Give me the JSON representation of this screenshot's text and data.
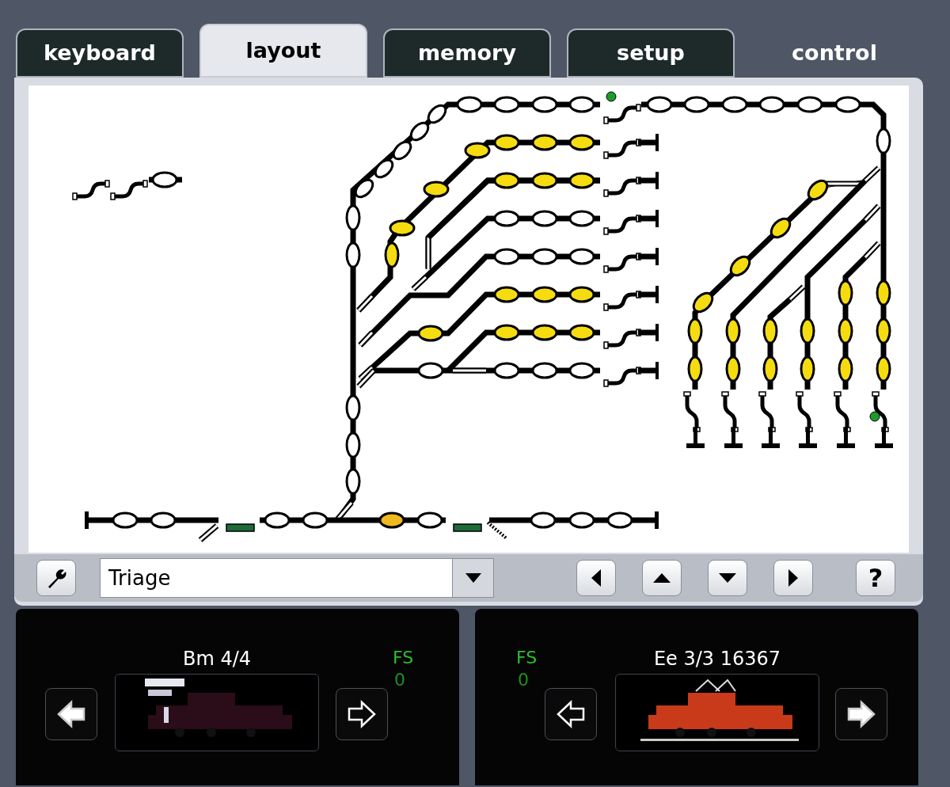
{
  "tabs": [
    {
      "label": "keyboard",
      "selected": false,
      "kind": "boxed"
    },
    {
      "label": "layout",
      "selected": true,
      "kind": "boxed"
    },
    {
      "label": "memory",
      "selected": false,
      "kind": "boxed"
    },
    {
      "label": "setup",
      "selected": false,
      "kind": "boxed"
    },
    {
      "label": "control",
      "selected": false,
      "kind": "plain"
    }
  ],
  "toolbar": {
    "layout_select": {
      "value": "Triage"
    },
    "help": "?"
  },
  "locos": [
    {
      "name": "Bm 4/4",
      "fs_label": "FS",
      "speed": "0",
      "forward": false
    },
    {
      "name": "Ee 3/3 16367",
      "fs_label": "FS",
      "speed": "0",
      "forward": true
    }
  ]
}
